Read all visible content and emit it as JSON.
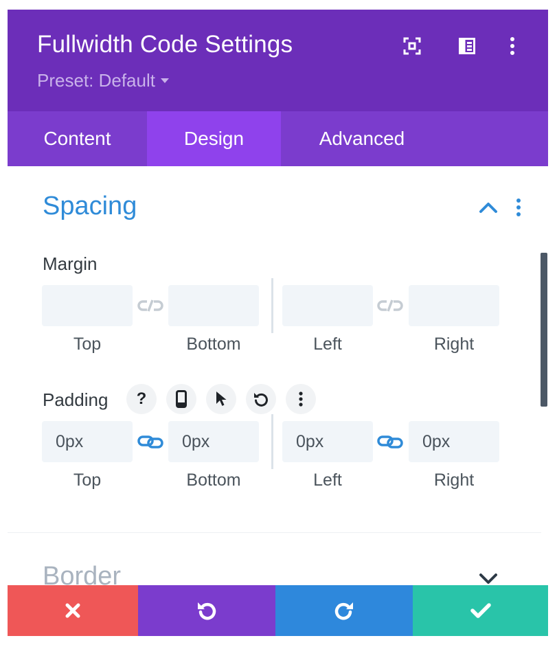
{
  "header": {
    "title": "Fullwidth Code Settings",
    "preset_label": "Preset: Default",
    "icons": [
      "expand-icon",
      "sidebar-layout-icon",
      "more-vertical-icon"
    ]
  },
  "tabs": [
    {
      "label": "Content",
      "active": false
    },
    {
      "label": "Design",
      "active": true
    },
    {
      "label": "Advanced",
      "active": false
    }
  ],
  "spacing": {
    "title": "Spacing",
    "margin": {
      "label": "Margin",
      "fields": [
        {
          "label": "Top",
          "value": ""
        },
        {
          "label": "Bottom",
          "value": ""
        },
        {
          "label": "Left",
          "value": ""
        },
        {
          "label": "Right",
          "value": ""
        }
      ],
      "linked": false
    },
    "padding": {
      "label": "Padding",
      "tools": [
        "help-icon",
        "mobile-icon",
        "cursor-icon",
        "reset-icon",
        "more-vertical-icon"
      ],
      "fields": [
        {
          "label": "Top",
          "value": "0px"
        },
        {
          "label": "Bottom",
          "value": "0px"
        },
        {
          "label": "Left",
          "value": "0px"
        },
        {
          "label": "Right",
          "value": "0px"
        }
      ],
      "linked": true
    }
  },
  "border": {
    "title": "Border"
  },
  "footer": {
    "buttons": [
      "cancel-button",
      "undo-button",
      "redo-button",
      "save-button"
    ]
  },
  "colors": {
    "header_bg": "#6c2eb9",
    "tabs_bg": "#7b3ccd",
    "active_tab_bg": "#8f42ec",
    "accent_blue": "#2f8bd8",
    "cancel": "#ef5757",
    "undo": "#7b3ccd",
    "redo": "#2e88dc",
    "save": "#29c4a9"
  }
}
